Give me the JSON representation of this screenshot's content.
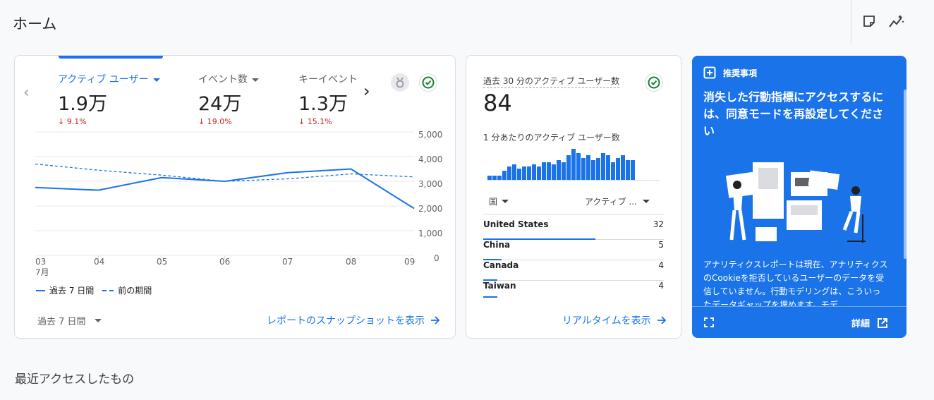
{
  "page": {
    "title": "ホーム"
  },
  "header": {
    "icons": [
      "note-icon",
      "insights-icon"
    ]
  },
  "overview": {
    "metrics": [
      {
        "label": "アクティブ ユーザー",
        "value": "1.9万",
        "delta": "9.1%",
        "active": true
      },
      {
        "label": "イベント数",
        "value": "24万",
        "delta": "19.0%",
        "active": false
      },
      {
        "label": "キーイベント",
        "value": "1.3万",
        "delta": "15.1%",
        "active": false
      }
    ],
    "y_ticks": [
      "5,000",
      "4,000",
      "3,000",
      "2,000",
      "1,000",
      "0"
    ],
    "x_ticks": [
      "03",
      "04",
      "05",
      "06",
      "07",
      "08",
      "09"
    ],
    "x_month": "7月",
    "legend_current": "過去 7 日間",
    "legend_previous": "前の期間",
    "date_range": "過去 7 日間",
    "snapshot_link": "レポートのスナップショットを表示"
  },
  "chart_data": {
    "type": "line",
    "categories": [
      "03",
      "04",
      "05",
      "06",
      "07",
      "08",
      "09"
    ],
    "ylim": [
      0,
      5000
    ],
    "series": [
      {
        "name": "過去 7 日間",
        "values": [
          2750,
          2640,
          3150,
          3000,
          3350,
          3500,
          1900
        ],
        "style": "solid"
      },
      {
        "name": "前の期間",
        "values": [
          3700,
          3450,
          3250,
          3000,
          3100,
          3300,
          3180
        ],
        "style": "dashed"
      }
    ],
    "color": "#1a73e8"
  },
  "realtime": {
    "title": "過去 30 分のアクティブ ユーザー数",
    "value": "84",
    "subtitle": "1 分あたりのアクティブ ユーザー数",
    "bars": [
      2,
      2,
      2,
      4,
      6,
      7,
      5,
      6,
      6,
      7,
      6,
      8,
      8,
      7,
      9,
      8,
      11,
      14,
      12,
      10,
      11,
      9,
      10,
      12,
      11,
      8,
      10,
      11,
      9,
      9
    ],
    "col_country": "国",
    "col_users": "アクティブ ...",
    "rows": [
      {
        "country": "United States",
        "users": "32",
        "share": 0.62
      },
      {
        "country": "China",
        "users": "5",
        "share": 0.1
      },
      {
        "country": "Canada",
        "users": "4",
        "share": 0.08
      },
      {
        "country": "Taiwan",
        "users": "4",
        "share": 0.08
      }
    ],
    "link": "リアルタイムを表示"
  },
  "recommendation": {
    "header": "推奨事項",
    "title": "消失した行動指標にアクセスするには、同意モードを再設定してください",
    "body": "アナリティクスレポートは現在、アナリティクスのCookieを拒否しているユーザーのデータを受信していません。行動モデリングは、こういったデータギャップを埋めます。モデ",
    "details": "詳細",
    "bg_color": "#1a73e8"
  },
  "recent": {
    "title": "最近アクセスしたもの"
  }
}
